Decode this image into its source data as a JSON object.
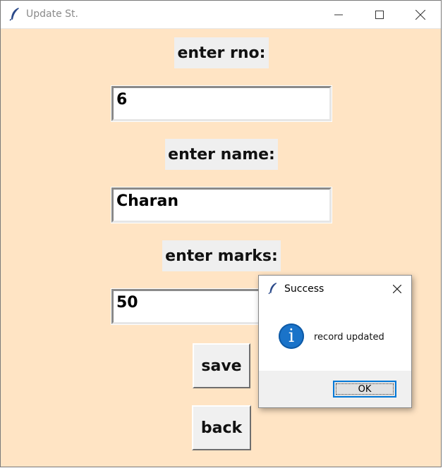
{
  "window": {
    "title": "Update St.",
    "icon": "feather-icon",
    "controls": [
      "minimize-icon",
      "maximize-icon",
      "close-icon"
    ]
  },
  "form": {
    "rno_label": "enter rno:",
    "rno_value": "6",
    "name_label": "enter name:",
    "name_value": "Charan",
    "marks_label": "enter marks:",
    "marks_value": "50",
    "save_label": "save",
    "back_label": "back"
  },
  "dialog": {
    "title": "Success",
    "message": "record updated",
    "ok_label": "OK",
    "icon": "info-icon"
  },
  "colors": {
    "background": "#ffe4c4",
    "accent": "#0078d7",
    "info": "#1a73c9"
  }
}
